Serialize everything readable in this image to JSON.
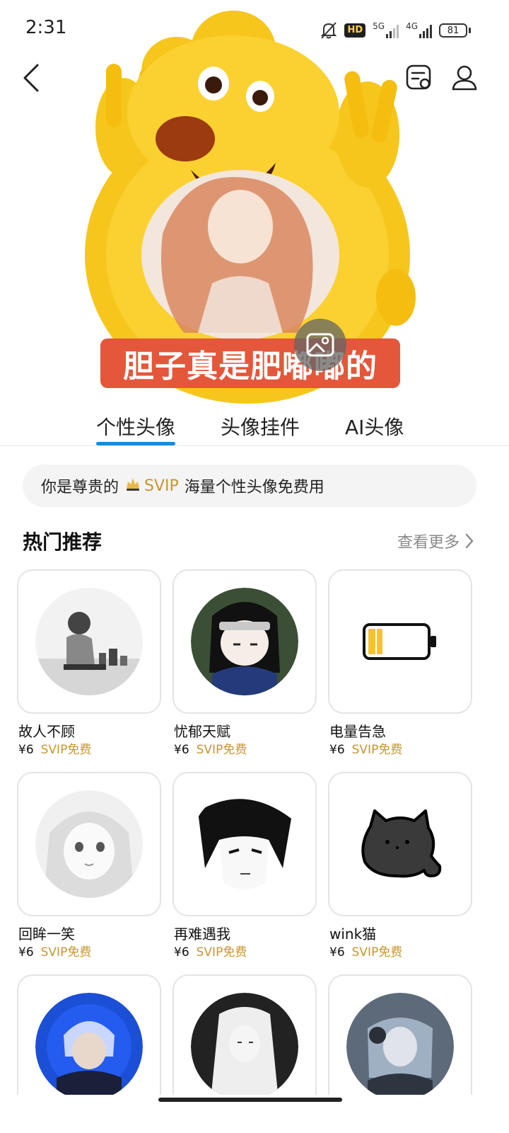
{
  "status_bar": {
    "time": "2:31",
    "hd_badge": "HD",
    "net_1": "5G",
    "net_2": "4G",
    "battery": "81"
  },
  "top_bar": {
    "back_icon": "chevron-left-icon",
    "card_icon": "id-card-icon",
    "user_icon": "user-icon"
  },
  "hero": {
    "caption": "胆子真是肥嘟嘟的",
    "preview_icon": "image-icon"
  },
  "tabs": [
    {
      "label": "个性头像",
      "active": true
    },
    {
      "label": "头像挂件",
      "active": false
    },
    {
      "label": "AI头像",
      "active": false
    }
  ],
  "svip_banner": {
    "prefix": "你是尊贵的",
    "badge": "SVIP",
    "suffix": "海量个性头像免费用"
  },
  "section": {
    "title": "热门推荐",
    "see_more": "查看更多"
  },
  "items": [
    {
      "name": "故人不顾",
      "price": "¥6",
      "free": "SVIP免费"
    },
    {
      "name": "忧郁天赋",
      "price": "¥6",
      "free": "SVIP免费"
    },
    {
      "name": "电量告急",
      "price": "¥6",
      "free": "SVIP免费"
    },
    {
      "name": "回眸一笑",
      "price": "¥6",
      "free": "SVIP免费"
    },
    {
      "name": "再难遇我",
      "price": "¥6",
      "free": "SVIP免费"
    },
    {
      "name": "wink猫",
      "price": "¥6",
      "free": "SVIP免费"
    }
  ],
  "colors": {
    "accent_blue": "#1a8ad8",
    "svip_gold": "#c8962e",
    "caption_red": "#e4573a",
    "mascot_yellow": "#f7c61c"
  }
}
